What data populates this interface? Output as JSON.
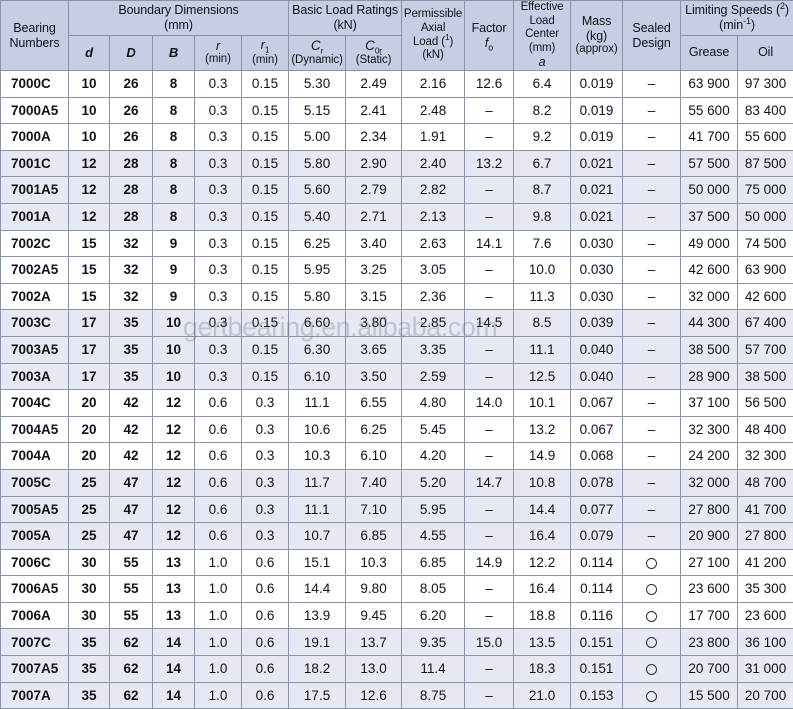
{
  "watermark": {
    "text": "gertbearing.en.alibaba.com"
  },
  "table": {
    "header": {
      "bearing_numbers": "Bearing Numbers",
      "boundary_dimensions": "Boundary Dimensions",
      "boundary_dimensions_unit": "(mm)",
      "d": "d",
      "D": "D",
      "B": "B",
      "r": "r",
      "r_min": "(min)",
      "r1": "r",
      "r1_sub": "1",
      "r1_min": "(min)",
      "basic_load_ratings": "Basic Load Ratings",
      "basic_load_ratings_unit": "(kN)",
      "cr": "C",
      "cr_sub": "r",
      "cr_note": "(Dynamic)",
      "c0r": "C",
      "c0r_sub": "0r",
      "c0r_note": "(Static)",
      "permissible_1": "Permissible",
      "permissible_2": "Axial",
      "permissible_3": "Load (",
      "permissible_3_sup": "1",
      "permissible_3_end": ")",
      "permissible_4": "(kN)",
      "factor": "Factor",
      "factor_f": "f",
      "factor_sub": "o",
      "elc_1": "Effective Load",
      "elc_2": "Center",
      "elc_3": "(mm)",
      "elc_4": "a",
      "mass_1": "Mass",
      "mass_2": "(kg)",
      "mass_3": "(approx)",
      "sealed_1": "Sealed",
      "sealed_2": "Design",
      "limiting_speeds": "Limiting Speeds (",
      "limiting_speeds_sup": "2",
      "limiting_speeds_end": ")",
      "limiting_speeds_unit_pre": "(min",
      "limiting_speeds_unit_sup": "-1",
      "limiting_speeds_unit_end": ")",
      "grease": "Grease",
      "oil": "Oil"
    },
    "rows": [
      {
        "band": "a",
        "bearing": "7000C",
        "d": "10",
        "D": "26",
        "B": "8",
        "r": "0.3",
        "r1": "0.15",
        "cr": "5.30",
        "c0r": "2.49",
        "axial": "2.16",
        "factor": "12.6",
        "elc": "6.4",
        "mass": "0.019",
        "sealed": "dash",
        "grease": "63 900",
        "oil": "97 300"
      },
      {
        "band": "a",
        "bearing": "7000A5",
        "d": "10",
        "D": "26",
        "B": "8",
        "r": "0.3",
        "r1": "0.15",
        "cr": "5.15",
        "c0r": "2.41",
        "axial": "2.48",
        "factor": "–",
        "elc": "8.2",
        "mass": "0.019",
        "sealed": "dash",
        "grease": "55 600",
        "oil": "83 400"
      },
      {
        "band": "a",
        "bearing": "7000A",
        "d": "10",
        "D": "26",
        "B": "8",
        "r": "0.3",
        "r1": "0.15",
        "cr": "5.00",
        "c0r": "2.34",
        "axial": "1.91",
        "factor": "–",
        "elc": "9.2",
        "mass": "0.019",
        "sealed": "dash",
        "grease": "41 700",
        "oil": "55 600"
      },
      {
        "band": "b",
        "bearing": "7001C",
        "d": "12",
        "D": "28",
        "B": "8",
        "r": "0.3",
        "r1": "0.15",
        "cr": "5.80",
        "c0r": "2.90",
        "axial": "2.40",
        "factor": "13.2",
        "elc": "6.7",
        "mass": "0.021",
        "sealed": "dash",
        "grease": "57 500",
        "oil": "87 500"
      },
      {
        "band": "b",
        "bearing": "7001A5",
        "d": "12",
        "D": "28",
        "B": "8",
        "r": "0.3",
        "r1": "0.15",
        "cr": "5.60",
        "c0r": "2.79",
        "axial": "2.82",
        "factor": "–",
        "elc": "8.7",
        "mass": "0.021",
        "sealed": "dash",
        "grease": "50 000",
        "oil": "75 000"
      },
      {
        "band": "b",
        "bearing": "7001A",
        "d": "12",
        "D": "28",
        "B": "8",
        "r": "0.3",
        "r1": "0.15",
        "cr": "5.40",
        "c0r": "2.71",
        "axial": "2.13",
        "factor": "–",
        "elc": "9.8",
        "mass": "0.021",
        "sealed": "dash",
        "grease": "37 500",
        "oil": "50 000"
      },
      {
        "band": "a",
        "bearing": "7002C",
        "d": "15",
        "D": "32",
        "B": "9",
        "r": "0.3",
        "r1": "0.15",
        "cr": "6.25",
        "c0r": "3.40",
        "axial": "2.63",
        "factor": "14.1",
        "elc": "7.6",
        "mass": "0.030",
        "sealed": "dash",
        "grease": "49 000",
        "oil": "74 500"
      },
      {
        "band": "a",
        "bearing": "7002A5",
        "d": "15",
        "D": "32",
        "B": "9",
        "r": "0.3",
        "r1": "0.15",
        "cr": "5.95",
        "c0r": "3.25",
        "axial": "3.05",
        "factor": "–",
        "elc": "10.0",
        "mass": "0.030",
        "sealed": "dash",
        "grease": "42 600",
        "oil": "63 900"
      },
      {
        "band": "a",
        "bearing": "7002A",
        "d": "15",
        "D": "32",
        "B": "9",
        "r": "0.3",
        "r1": "0.15",
        "cr": "5.80",
        "c0r": "3.15",
        "axial": "2.36",
        "factor": "–",
        "elc": "11.3",
        "mass": "0.030",
        "sealed": "dash",
        "grease": "32 000",
        "oil": "42 600"
      },
      {
        "band": "b",
        "bearing": "7003C",
        "d": "17",
        "D": "35",
        "B": "10",
        "r": "0.3",
        "r1": "0.15",
        "cr": "6.60",
        "c0r": "3.80",
        "axial": "2.85",
        "factor": "14.5",
        "elc": "8.5",
        "mass": "0.039",
        "sealed": "dash",
        "grease": "44 300",
        "oil": "67 400"
      },
      {
        "band": "b",
        "bearing": "7003A5",
        "d": "17",
        "D": "35",
        "B": "10",
        "r": "0.3",
        "r1": "0.15",
        "cr": "6.30",
        "c0r": "3.65",
        "axial": "3.35",
        "factor": "–",
        "elc": "11.1",
        "mass": "0.040",
        "sealed": "dash",
        "grease": "38 500",
        "oil": "57 700"
      },
      {
        "band": "b",
        "bearing": "7003A",
        "d": "17",
        "D": "35",
        "B": "10",
        "r": "0.3",
        "r1": "0.15",
        "cr": "6.10",
        "c0r": "3.50",
        "axial": "2.59",
        "factor": "–",
        "elc": "12.5",
        "mass": "0.040",
        "sealed": "dash",
        "grease": "28 900",
        "oil": "38 500"
      },
      {
        "band": "a",
        "bearing": "7004C",
        "d": "20",
        "D": "42",
        "B": "12",
        "r": "0.6",
        "r1": "0.3",
        "cr": "11.1",
        "c0r": "6.55",
        "axial": "4.80",
        "factor": "14.0",
        "elc": "10.1",
        "mass": "0.067",
        "sealed": "dash",
        "grease": "37 100",
        "oil": "56 500"
      },
      {
        "band": "a",
        "bearing": "7004A5",
        "d": "20",
        "D": "42",
        "B": "12",
        "r": "0.6",
        "r1": "0.3",
        "cr": "10.6",
        "c0r": "6.25",
        "axial": "5.45",
        "factor": "–",
        "elc": "13.2",
        "mass": "0.067",
        "sealed": "dash",
        "grease": "32 300",
        "oil": "48 400"
      },
      {
        "band": "a",
        "bearing": "7004A",
        "d": "20",
        "D": "42",
        "B": "12",
        "r": "0.6",
        "r1": "0.3",
        "cr": "10.3",
        "c0r": "6.10",
        "axial": "4.20",
        "factor": "–",
        "elc": "14.9",
        "mass": "0.068",
        "sealed": "dash",
        "grease": "24 200",
        "oil": "32 300"
      },
      {
        "band": "b",
        "bearing": "7005C",
        "d": "25",
        "D": "47",
        "B": "12",
        "r": "0.6",
        "r1": "0.3",
        "cr": "11.7",
        "c0r": "7.40",
        "axial": "5.20",
        "factor": "14.7",
        "elc": "10.8",
        "mass": "0.078",
        "sealed": "dash",
        "grease": "32 000",
        "oil": "48 700"
      },
      {
        "band": "b",
        "bearing": "7005A5",
        "d": "25",
        "D": "47",
        "B": "12",
        "r": "0.6",
        "r1": "0.3",
        "cr": "11.1",
        "c0r": "7.10",
        "axial": "5.95",
        "factor": "–",
        "elc": "14.4",
        "mass": "0.077",
        "sealed": "dash",
        "grease": "27 800",
        "oil": "41 700"
      },
      {
        "band": "b",
        "bearing": "7005A",
        "d": "25",
        "D": "47",
        "B": "12",
        "r": "0.6",
        "r1": "0.3",
        "cr": "10.7",
        "c0r": "6.85",
        "axial": "4.55",
        "factor": "–",
        "elc": "16.4",
        "mass": "0.079",
        "sealed": "dash",
        "grease": "20 900",
        "oil": "27 800"
      },
      {
        "band": "a",
        "bearing": "7006C",
        "d": "30",
        "D": "55",
        "B": "13",
        "r": "1.0",
        "r1": "0.6",
        "cr": "15.1",
        "c0r": "10.3",
        "axial": "6.85",
        "factor": "14.9",
        "elc": "12.2",
        "mass": "0.114",
        "sealed": "circle",
        "grease": "27 100",
        "oil": "41 200"
      },
      {
        "band": "a",
        "bearing": "7006A5",
        "d": "30",
        "D": "55",
        "B": "13",
        "r": "1.0",
        "r1": "0.6",
        "cr": "14.4",
        "c0r": "9.80",
        "axial": "8.05",
        "factor": "–",
        "elc": "16.4",
        "mass": "0.114",
        "sealed": "circle",
        "grease": "23 600",
        "oil": "35 300"
      },
      {
        "band": "a",
        "bearing": "7006A",
        "d": "30",
        "D": "55",
        "B": "13",
        "r": "1.0",
        "r1": "0.6",
        "cr": "13.9",
        "c0r": "9.45",
        "axial": "6.20",
        "factor": "–",
        "elc": "18.8",
        "mass": "0.116",
        "sealed": "circle",
        "grease": "17 700",
        "oil": "23 600"
      },
      {
        "band": "b",
        "bearing": "7007C",
        "d": "35",
        "D": "62",
        "B": "14",
        "r": "1.0",
        "r1": "0.6",
        "cr": "19.1",
        "c0r": "13.7",
        "axial": "9.35",
        "factor": "15.0",
        "elc": "13.5",
        "mass": "0.151",
        "sealed": "circle",
        "grease": "23 800",
        "oil": "36 100"
      },
      {
        "band": "b",
        "bearing": "7007A5",
        "d": "35",
        "D": "62",
        "B": "14",
        "r": "1.0",
        "r1": "0.6",
        "cr": "18.2",
        "c0r": "13.0",
        "axial": "11.4",
        "factor": "–",
        "elc": "18.3",
        "mass": "0.151",
        "sealed": "circle",
        "grease": "20 700",
        "oil": "31 000"
      },
      {
        "band": "b",
        "bearing": "7007A",
        "d": "35",
        "D": "62",
        "B": "14",
        "r": "1.0",
        "r1": "0.6",
        "cr": "17.5",
        "c0r": "12.6",
        "axial": "8.75",
        "factor": "–",
        "elc": "21.0",
        "mass": "0.153",
        "sealed": "circle",
        "grease": "15 500",
        "oil": "20 700"
      }
    ]
  }
}
